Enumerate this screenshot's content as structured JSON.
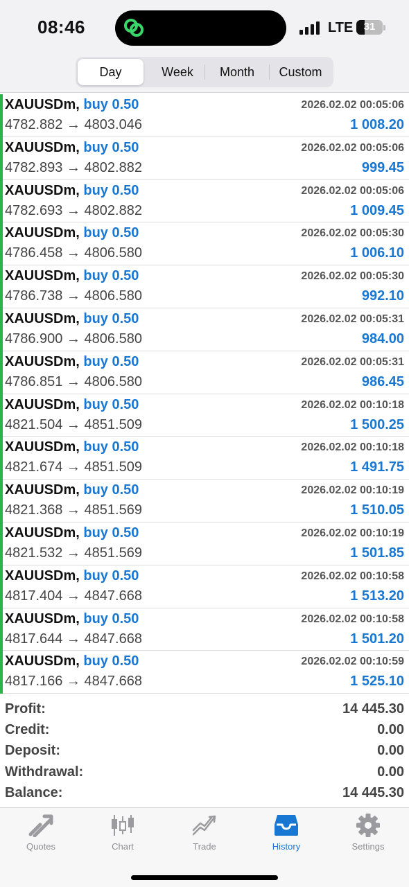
{
  "status": {
    "time": "08:46",
    "network": "LTE",
    "battery": "31"
  },
  "period_tabs": [
    "Day",
    "Week",
    "Month",
    "Custom"
  ],
  "deals": [
    {
      "symbol": "XAUUSDm,",
      "action": "buy 0.50",
      "date": "2026.02.02 00:05:06",
      "prices": "4782.882 → 4803.046",
      "profit": "1 008.20"
    },
    {
      "symbol": "XAUUSDm,",
      "action": "buy 0.50",
      "date": "2026.02.02 00:05:06",
      "prices": "4782.893 → 4802.882",
      "profit": "999.45"
    },
    {
      "symbol": "XAUUSDm,",
      "action": "buy 0.50",
      "date": "2026.02.02 00:05:06",
      "prices": "4782.693 → 4802.882",
      "profit": "1 009.45"
    },
    {
      "symbol": "XAUUSDm,",
      "action": "buy 0.50",
      "date": "2026.02.02 00:05:30",
      "prices": "4786.458 → 4806.580",
      "profit": "1 006.10"
    },
    {
      "symbol": "XAUUSDm,",
      "action": "buy 0.50",
      "date": "2026.02.02 00:05:30",
      "prices": "4786.738 → 4806.580",
      "profit": "992.10"
    },
    {
      "symbol": "XAUUSDm,",
      "action": "buy 0.50",
      "date": "2026.02.02 00:05:31",
      "prices": "4786.900 → 4806.580",
      "profit": "984.00"
    },
    {
      "symbol": "XAUUSDm,",
      "action": "buy 0.50",
      "date": "2026.02.02 00:05:31",
      "prices": "4786.851 → 4806.580",
      "profit": "986.45"
    },
    {
      "symbol": "XAUUSDm,",
      "action": "buy 0.50",
      "date": "2026.02.02 00:10:18",
      "prices": "4821.504 → 4851.509",
      "profit": "1 500.25"
    },
    {
      "symbol": "XAUUSDm,",
      "action": "buy 0.50",
      "date": "2026.02.02 00:10:18",
      "prices": "4821.674 → 4851.509",
      "profit": "1 491.75"
    },
    {
      "symbol": "XAUUSDm,",
      "action": "buy 0.50",
      "date": "2026.02.02 00:10:19",
      "prices": "4821.368 → 4851.569",
      "profit": "1 510.05"
    },
    {
      "symbol": "XAUUSDm,",
      "action": "buy 0.50",
      "date": "2026.02.02 00:10:19",
      "prices": "4821.532 → 4851.569",
      "profit": "1 501.85"
    },
    {
      "symbol": "XAUUSDm,",
      "action": "buy 0.50",
      "date": "2026.02.02 00:10:58",
      "prices": "4817.404 → 4847.668",
      "profit": "1 513.20"
    },
    {
      "symbol": "XAUUSDm,",
      "action": "buy 0.50",
      "date": "2026.02.02 00:10:58",
      "prices": "4817.644 → 4847.668",
      "profit": "1 501.20"
    },
    {
      "symbol": "XAUUSDm,",
      "action": "buy 0.50",
      "date": "2026.02.02 00:10:59",
      "prices": "4817.166 → 4847.668",
      "profit": "1 525.10"
    }
  ],
  "summary": [
    {
      "label": "Profit:",
      "value": "14 445.30"
    },
    {
      "label": "Credit:",
      "value": "0.00"
    },
    {
      "label": "Deposit:",
      "value": "0.00"
    },
    {
      "label": "Withdrawal:",
      "value": "0.00"
    },
    {
      "label": "Balance:",
      "value": "14 445.30"
    }
  ],
  "tabbar": [
    {
      "label": "Quotes",
      "icon": "quotes-icon"
    },
    {
      "label": "Chart",
      "icon": "chart-icon"
    },
    {
      "label": "Trade",
      "icon": "trade-icon"
    },
    {
      "label": "History",
      "icon": "history-icon"
    },
    {
      "label": "Settings",
      "icon": "gear-icon"
    }
  ],
  "colors": {
    "accent": "#1877d2",
    "buy_bar": "#2db34a",
    "muted": "#8e8e93"
  }
}
